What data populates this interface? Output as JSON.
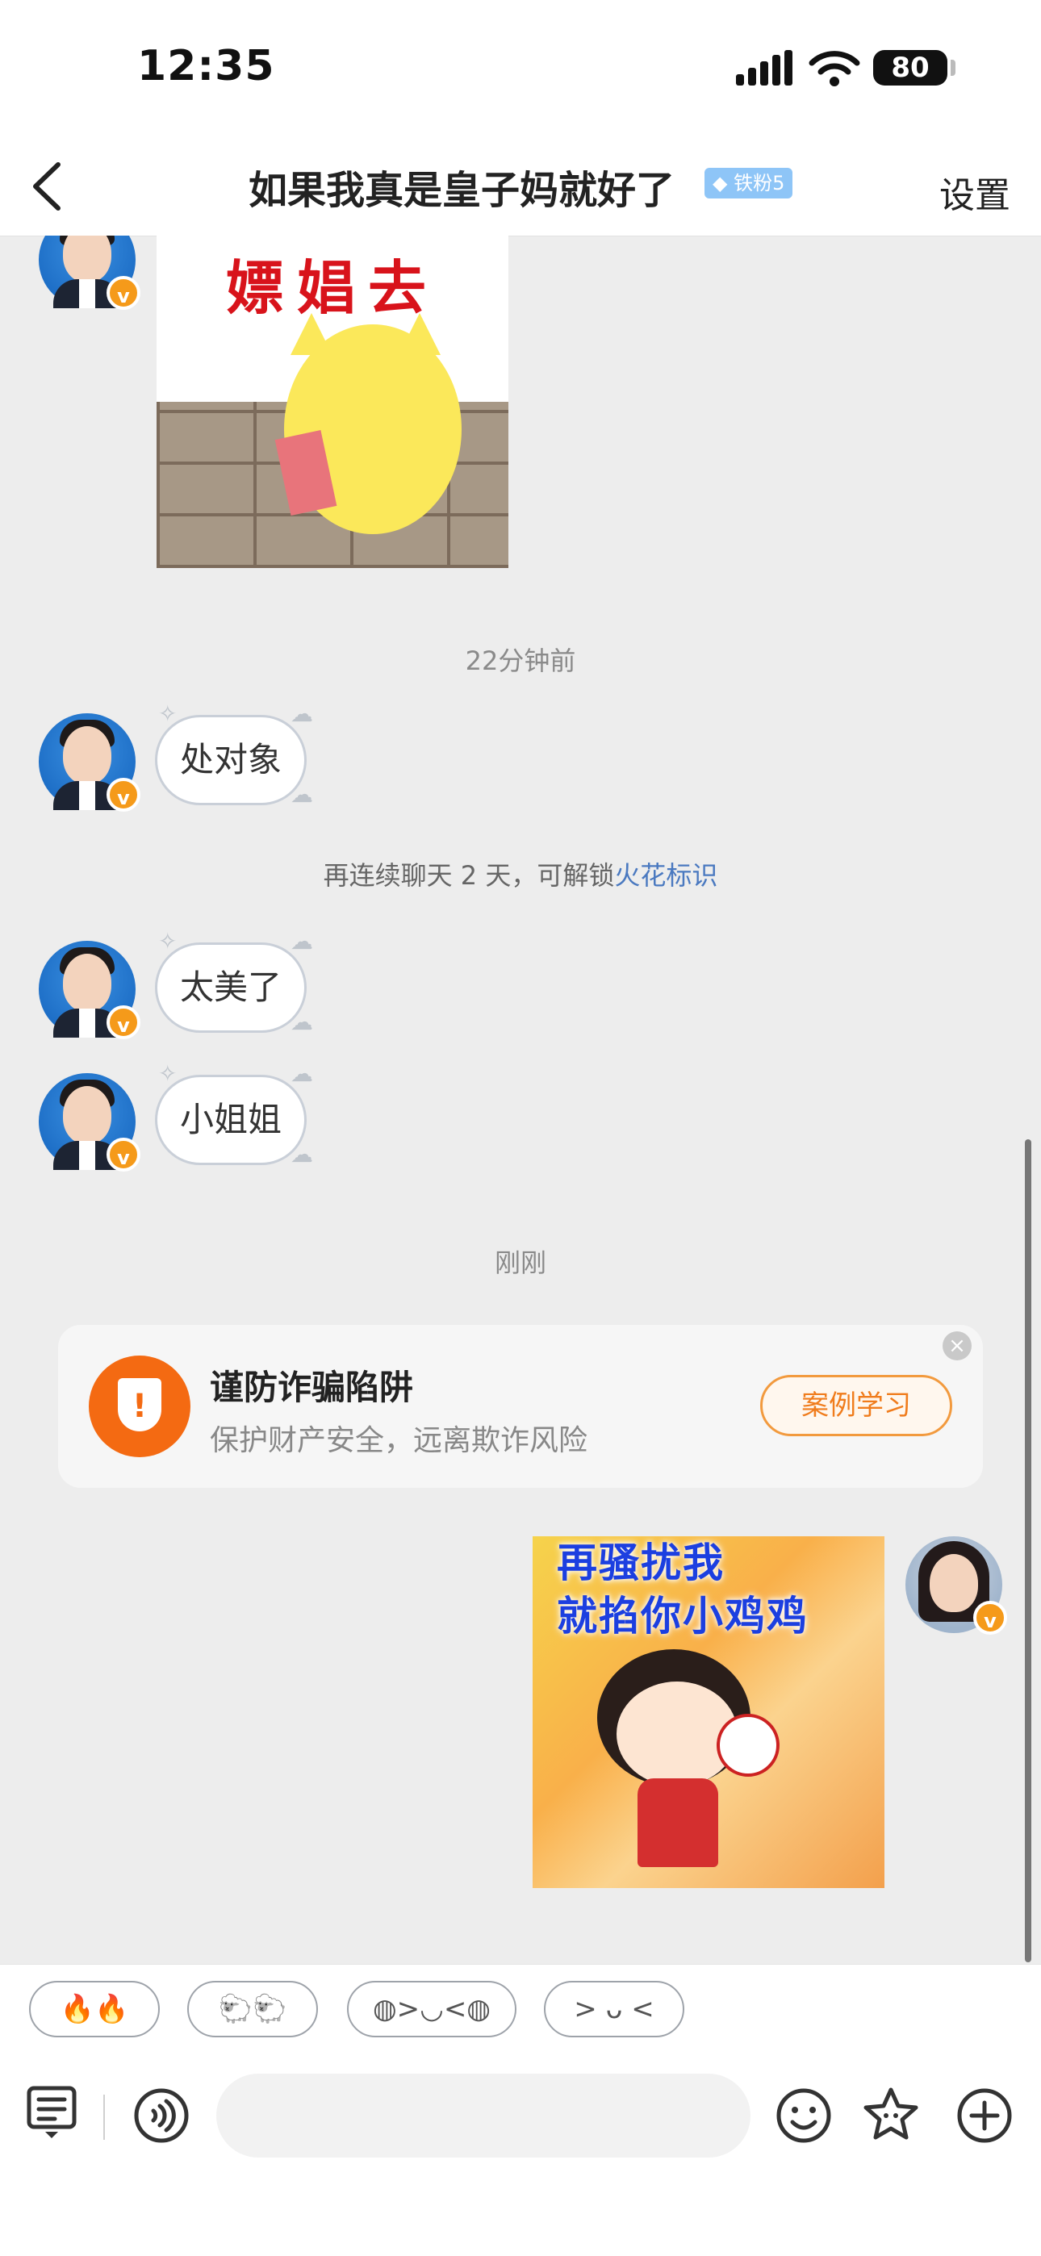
{
  "status_bar": {
    "time": "12:35",
    "battery": "80"
  },
  "nav": {
    "title": "如果我真是皇子妈就好了",
    "fan_badge": "铁粉5",
    "settings": "设置"
  },
  "messages": {
    "sticker_cat_caption": "嫖娼去",
    "time_1": "22分钟前",
    "bubble_1": "处对象",
    "hint_prefix": "再连续聊天 2 天，可解锁",
    "hint_link": "火花标识",
    "bubble_2": "太美了",
    "bubble_3": "小姐姐",
    "time_2": "刚刚",
    "sticker_girl_caption_1": "再骚扰我",
    "sticker_girl_caption_2": "就掐你小鸡鸡"
  },
  "fraud_card": {
    "title": "谨防诈骗陷阱",
    "subtitle": "保护财产安全，远离欺诈风险",
    "button": "案例学习"
  },
  "quick_replies": [
    "🔥🔥",
    "🐑🐑",
    "◍>◡<◍",
    "> ᴗ <"
  ],
  "input": {
    "placeholder": ""
  },
  "icons": {
    "back": "chevron-left-icon",
    "signal": "signal-icon",
    "wifi": "wifi-icon",
    "note": "note-icon",
    "voice": "voice-icon",
    "emoji": "emoji-icon",
    "star": "star-sticker-icon",
    "plus": "plus-icon"
  },
  "colors": {
    "accent_orange": "#f46a12",
    "link_blue": "#4a79c0",
    "badge_blue": "#8ec5f7",
    "verified": "#f59a1a"
  }
}
